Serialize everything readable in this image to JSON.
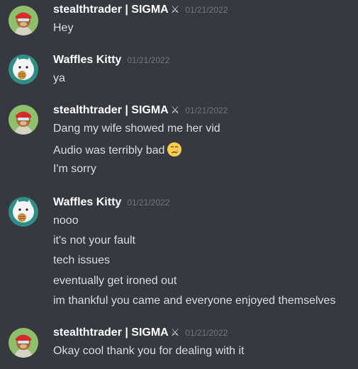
{
  "messages": [
    {
      "author": "stealthtrader | SIGMA",
      "badge": "⚔",
      "timestamp": "01/21/2022",
      "avatar": "ape-avatar",
      "lines": [
        "Hey"
      ]
    },
    {
      "author": "Waffles Kitty",
      "badge": "",
      "timestamp": "01/21/2022",
      "avatar": "cat-avatar",
      "lines": [
        "ya"
      ]
    },
    {
      "author": "stealthtrader | SIGMA",
      "badge": "⚔",
      "timestamp": "01/21/2022",
      "avatar": "ape-avatar",
      "lines": [
        "Dang my wife showed me her vid",
        "Audio was terribly bad",
        "I'm sorry"
      ],
      "emoji": "crying-face-emoji"
    },
    {
      "author": "Waffles Kitty",
      "badge": "",
      "timestamp": "01/21/2022",
      "avatar": "cat-avatar",
      "lines": [
        "nooo",
        "it's not your fault",
        "tech issues",
        "eventually get ironed out",
        "im thankful you came and everyone enjoyed themselves"
      ]
    },
    {
      "author": "stealthtrader | SIGMA",
      "badge": "⚔",
      "timestamp": "01/21/2022",
      "avatar": "ape-avatar",
      "lines": [
        "Okay cool thank you for dealing with it"
      ]
    }
  ],
  "colors": {
    "background": "#36393f",
    "username": "#ffffff",
    "message_text": "#dcddde",
    "timestamp": "#72767d"
  }
}
